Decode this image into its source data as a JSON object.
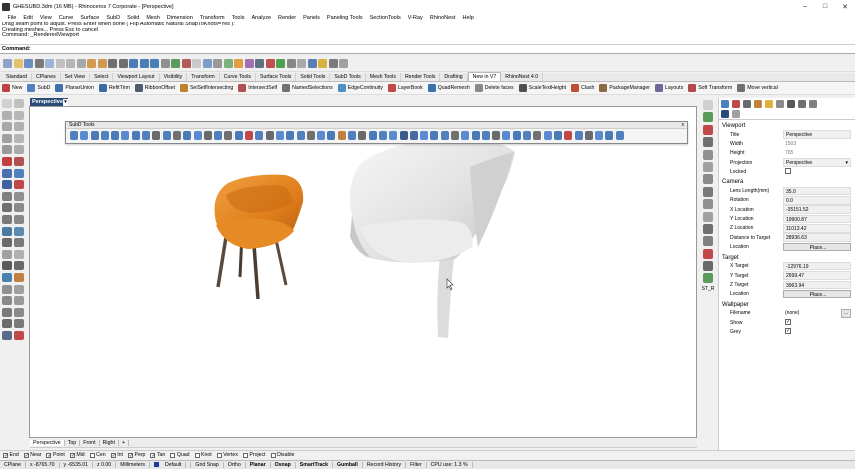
{
  "window": {
    "title": "GHESUBD.3dm (16 MB) - Rhinoceros 7 Corporate - [Perspective]",
    "minimize": "–",
    "maximize": "□",
    "close": "✕"
  },
  "menu": [
    "File",
    "Edit",
    "View",
    "Curve",
    "Surface",
    "SubD",
    "Solid",
    "Mesh",
    "Dimension",
    "Transform",
    "Tools",
    "Analyze",
    "Render",
    "Panels",
    "Paneling Tools",
    "SectionTools",
    "V-Ray",
    "RhinoNest",
    "Help"
  ],
  "command_history": [
    "Drag seam point to adjust. Press Enter when done ( Flip  Automatic  Natural  SnapToKnots=Yes ):",
    "Creating meshes... Press Esc to cancel",
    "Command: _RenderedViewport"
  ],
  "command_prompt": "Command:",
  "toolbar_tabs": [
    "Standard",
    "CPlanes",
    "Set View",
    "Select",
    "Viewport Layout",
    "Visibility",
    "Transform",
    "Curve Tools",
    "Surface Tools",
    "Solid Tools",
    "SubD Tools",
    "Mesh Tools",
    "Render Tools",
    "Drafting",
    "New in V7",
    "RhinoNest 4.0"
  ],
  "active_toolbar_tab": "New in V7",
  "command_buttons": [
    "New",
    "SubD",
    "PlanarUnion",
    "RefitTrim",
    "RibbonOffset",
    "SelSelfIntersecting",
    "IntersectSelf",
    "NamedSelections",
    "EdgeContinuity",
    "LayerBook",
    "QuadRemesh",
    "Delete faces",
    "ScaleTextHeight",
    "Clash",
    "PackageManager",
    "Layouts",
    "Soft Transform",
    "Move vertical"
  ],
  "viewport": {
    "name": "Perspective"
  },
  "subd_toolbar": {
    "title": "SubD Tools",
    "close": "x"
  },
  "viewport_tabs": [
    "Perspective",
    "Top",
    "Front",
    "Right"
  ],
  "add_tab": "+",
  "osnaps": [
    {
      "label": "End",
      "checked": true
    },
    {
      "label": "Near",
      "checked": true
    },
    {
      "label": "Point",
      "checked": true
    },
    {
      "label": "Mid",
      "checked": true
    },
    {
      "label": "Cen",
      "checked": false
    },
    {
      "label": "Int",
      "checked": true
    },
    {
      "label": "Perp",
      "checked": true
    },
    {
      "label": "Tan",
      "checked": true
    },
    {
      "label": "Quad",
      "checked": false
    },
    {
      "label": "Knot",
      "checked": false
    },
    {
      "label": "Vertex",
      "checked": false
    },
    {
      "label": "Project",
      "checked": false
    },
    {
      "label": "Disable",
      "checked": false
    }
  ],
  "status": {
    "cplane": "CPlane",
    "x": "x -8765.70",
    "y": "y -6535.01",
    "z": "z 0.00",
    "units": "Millimeters",
    "layer": "Default",
    "grid_snap": "Grid Snap",
    "ortho": "Ortho",
    "planar": "Planar",
    "osnap": "Osnap",
    "smarttrack": "SmartTrack",
    "gumball": "Gumball",
    "record_history": "Record History",
    "filter": "Filter",
    "cpu": "CPU use: 1.3 %"
  },
  "side_label": "ST_R",
  "properties": {
    "viewport_header": "Viewport",
    "viewport_rows": [
      {
        "key": "Title",
        "value": "Perspective",
        "dim": false
      },
      {
        "key": "Width",
        "value": "1503",
        "dim": true
      },
      {
        "key": "Height",
        "value": "765",
        "dim": true
      },
      {
        "key": "Projection",
        "value": "Perspective",
        "dim": false
      },
      {
        "key": "Locked",
        "value": "",
        "dim": false
      }
    ],
    "camera_header": "Camera",
    "camera_rows": [
      {
        "key": "Lens Length(mm)",
        "value": "35.0"
      },
      {
        "key": "Rotation",
        "value": "0.0"
      },
      {
        "key": "X Location",
        "value": "-35151.52"
      },
      {
        "key": "Y Location",
        "value": "19900.87"
      },
      {
        "key": "Z Location",
        "value": "11013.42"
      },
      {
        "key": "Distance to Target",
        "value": "28936.63"
      }
    ],
    "camera_location_key": "Location",
    "camera_location_btn": "Place...",
    "target_header": "Target",
    "target_rows": [
      {
        "key": "X Target",
        "value": "-12976.19"
      },
      {
        "key": "Y Target",
        "value": "2699.47"
      },
      {
        "key": "Z Target",
        "value": "3963.94"
      }
    ],
    "target_location_key": "Location",
    "target_location_btn": "Place...",
    "wallpaper_header": "Wallpaper",
    "filename_key": "Filename",
    "filename_value": "(none)",
    "filename_btn": "...",
    "show_key": "Show",
    "grey_key": "Grey"
  },
  "colors": {
    "accent": "#2a4a7a",
    "orange_chair": "#e07e1b",
    "white_chair": "#e4e4e4"
  }
}
